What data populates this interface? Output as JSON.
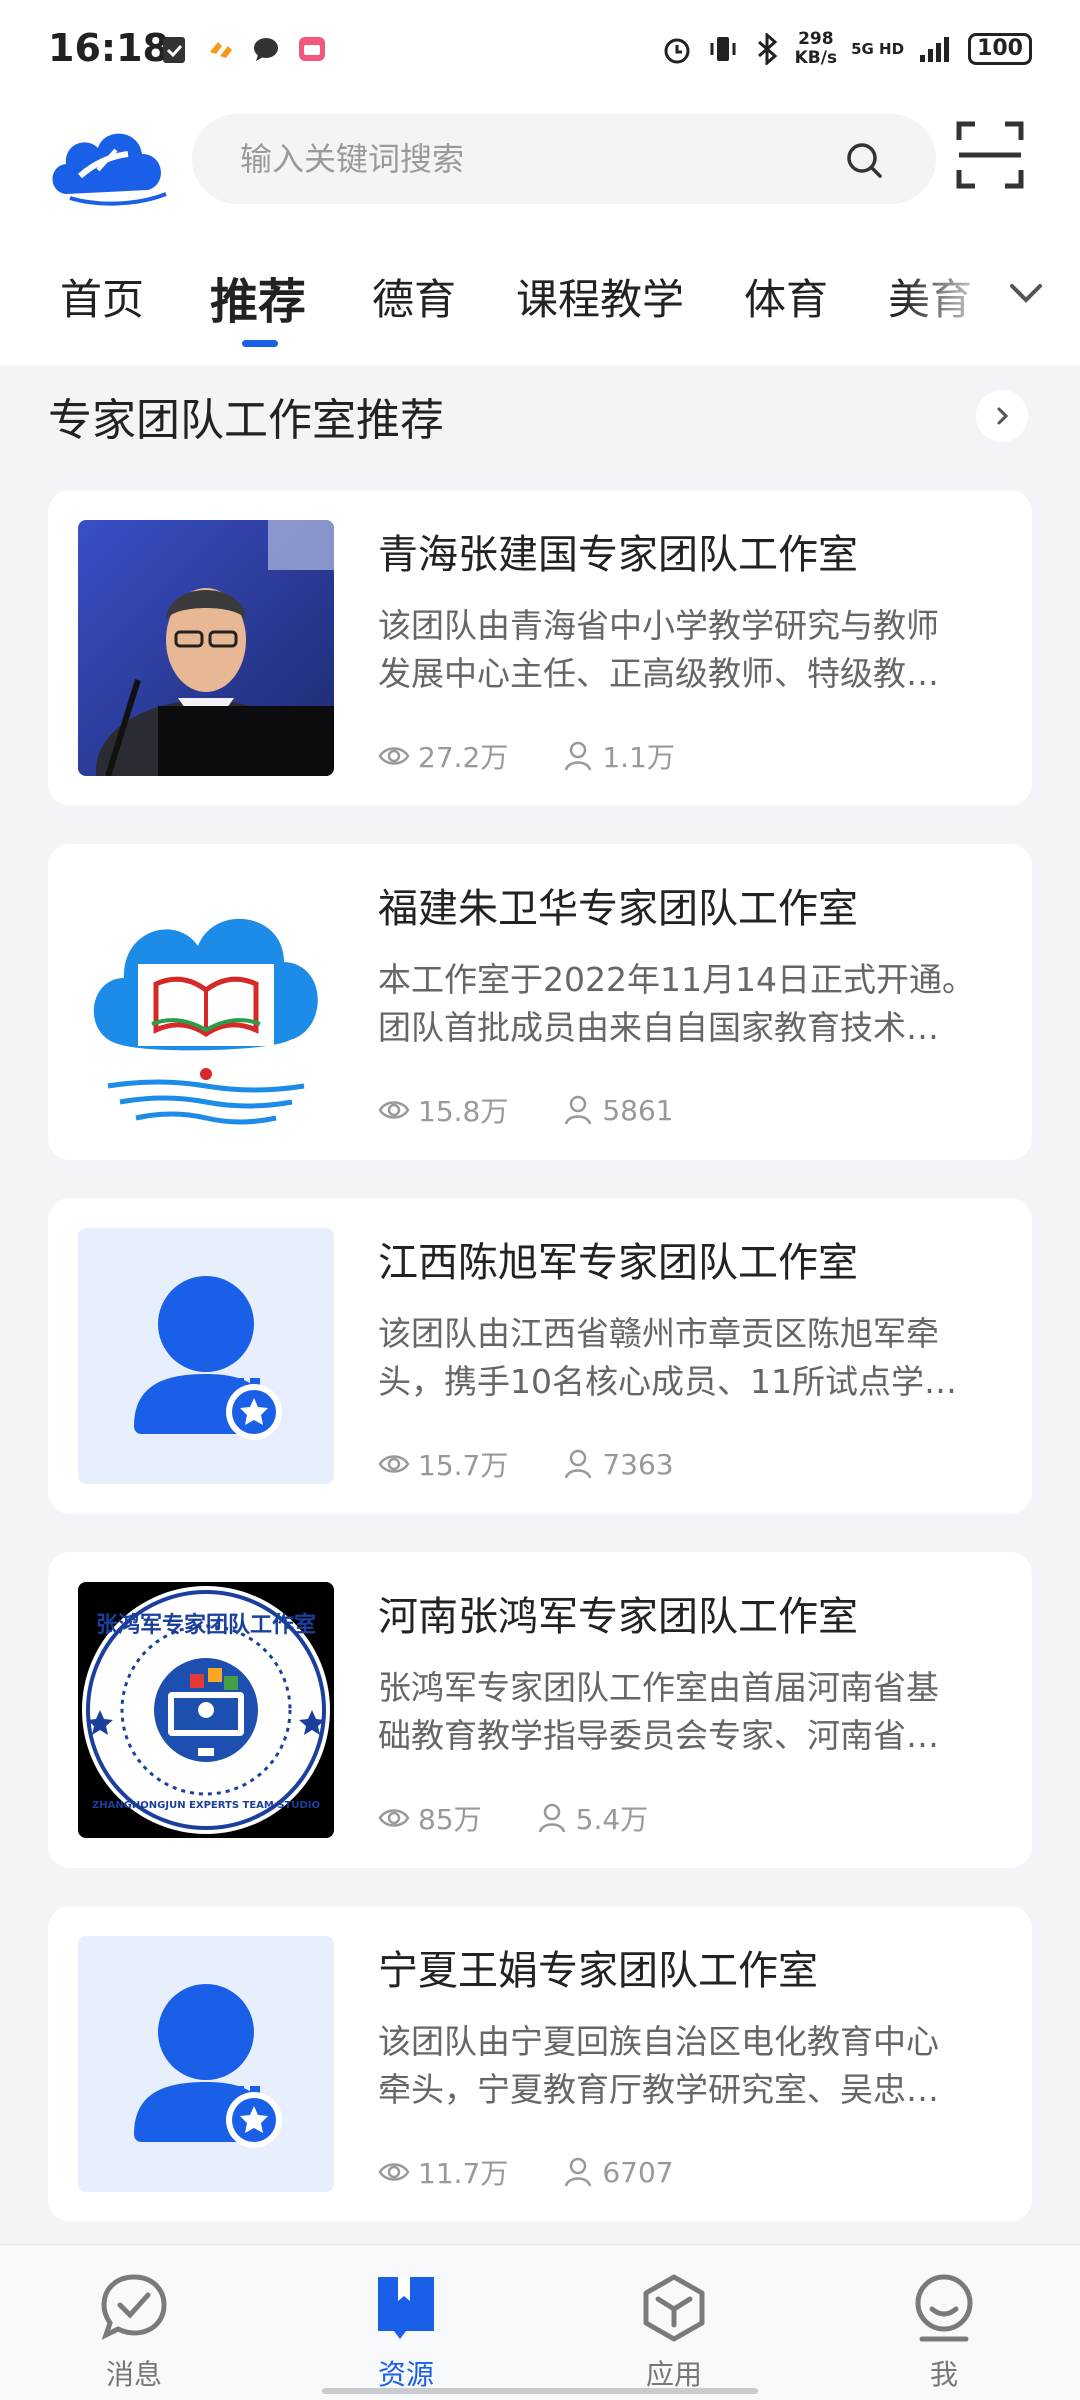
{
  "status_bar": {
    "time": "16:18",
    "speed_value": "298",
    "speed_unit": "KB/s",
    "network": "5G HD",
    "battery": "100"
  },
  "search": {
    "placeholder": "输入关键词搜索"
  },
  "tabs": [
    {
      "label": "首页"
    },
    {
      "label": "推荐"
    },
    {
      "label": "德育"
    },
    {
      "label": "课程教学"
    },
    {
      "label": "体育"
    },
    {
      "label": "美育"
    }
  ],
  "active_tab": "推荐",
  "section": {
    "title": "专家团队工作室推荐"
  },
  "cards": [
    {
      "title": "青海张建国专家团队工作室",
      "desc_line1": "该团队由青海省中小学教学研究与教师",
      "desc_line2": "发展中心主任、正高级教师、特级教…",
      "views": "27.2万",
      "members": "1.1万",
      "thumb": "photo"
    },
    {
      "title": "福建朱卫华专家团队工作室",
      "desc_line1": "本工作室于2022年11月14日正式开通。",
      "desc_line2": "团队首批成员由来自自国家教育技术…",
      "views": "15.8万",
      "members": "5861",
      "thumb": "logo-cloud"
    },
    {
      "title": "江西陈旭军专家团队工作室",
      "desc_line1": "该团队由江西省赣州市章贡区陈旭军牵",
      "desc_line2": "头，携手10名核心成员、11所试点学…",
      "views": "15.7万",
      "members": "7363",
      "thumb": "avatar-default"
    },
    {
      "title": "河南张鸿军专家团队工作室",
      "desc_line1": "张鸿军专家团队工作室由首届河南省基",
      "desc_line2": "础教育教学指导委员会专家、河南省…",
      "views": "85万",
      "members": "5.4万",
      "thumb": "seal",
      "seal_text_cn": "张鸿军专家团队工作室",
      "seal_text_en": "ZHANGHONGJUN EXPERTS TEAM STUDIO"
    },
    {
      "title": "宁夏王娟专家团队工作室",
      "desc_line1": "该团队由宁夏回族自治区电化教育中心",
      "desc_line2": "牵头，宁夏教育厅教学研究室、吴忠…",
      "views": "11.7万",
      "members": "6707",
      "thumb": "avatar-default"
    }
  ],
  "bottom_nav": [
    {
      "label": "消息",
      "icon": "check-bubble-icon"
    },
    {
      "label": "资源",
      "icon": "book-icon"
    },
    {
      "label": "应用",
      "icon": "cube-icon"
    },
    {
      "label": "我",
      "icon": "person-icon"
    }
  ],
  "active_nav": "资源",
  "colors": {
    "accent": "#1a5fe8",
    "background": "#f3f4f7",
    "card": "#ffffff",
    "text_primary": "#222222",
    "text_secondary": "#666666",
    "text_meta": "#999999"
  }
}
